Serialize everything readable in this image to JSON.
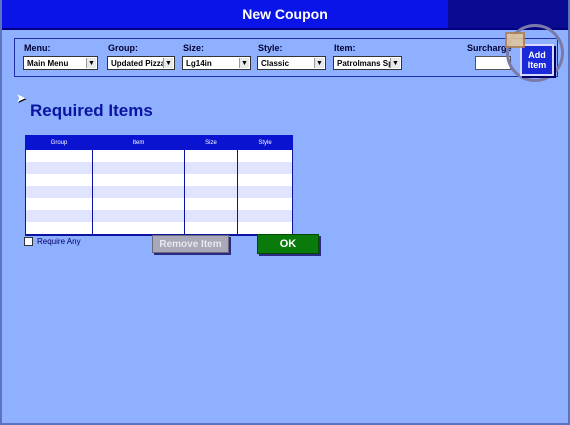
{
  "window": {
    "title": "New Coupon"
  },
  "filters": {
    "menu": {
      "label": "Menu:",
      "value": "Main Menu"
    },
    "group": {
      "label": "Group:",
      "value": "Updated Pizza"
    },
    "size": {
      "label": "Size:",
      "value": "Lg14in"
    },
    "style": {
      "label": "Style:",
      "value": "Classic"
    },
    "item": {
      "label": "Item:",
      "value": "Patrolmans Sp"
    },
    "surcharge": {
      "label": "Surcharge",
      "value": ""
    }
  },
  "add_item_label": "Add Item",
  "section_heading": "Required Items",
  "table": {
    "columns": [
      "Group",
      "Item",
      "Size",
      "Style"
    ],
    "rows": [
      [
        "",
        "",
        "",
        ""
      ],
      [
        "",
        "",
        "",
        ""
      ],
      [
        "",
        "",
        "",
        ""
      ],
      [
        "",
        "",
        "",
        ""
      ],
      [
        "",
        "",
        "",
        ""
      ],
      [
        "",
        "",
        "",
        ""
      ],
      [
        "",
        "",
        "",
        ""
      ]
    ]
  },
  "require_any": {
    "label": "Require Any",
    "checked": false
  },
  "remove_item_label": "Remove Item",
  "ok_label": "OK",
  "colors": {
    "background": "#8fb0ff",
    "titlebar": "#0a14e6",
    "ok_green": "#0a7a0a",
    "heading_blue": "#0a14a0"
  }
}
